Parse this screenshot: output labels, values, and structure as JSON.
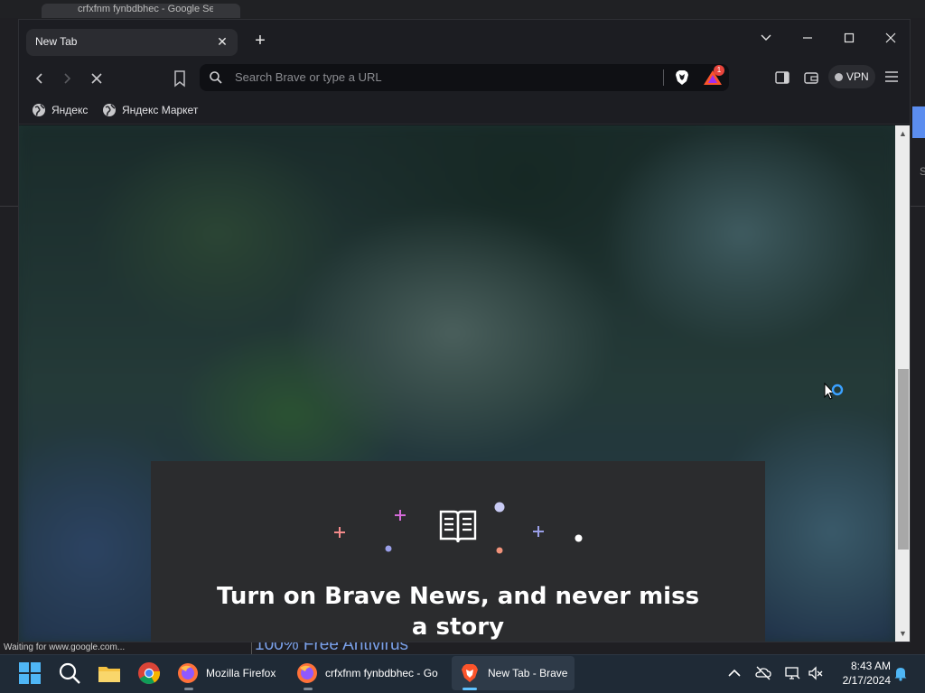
{
  "background_window": {
    "status_text": "Waiting for www.google.com...",
    "page_text": "100% Free Antivirus",
    "tab_title": "crfxfnm fynbdbhec - Google Se",
    "right_letter": "S"
  },
  "browser": {
    "tab": {
      "title": "New Tab",
      "close_glyph": "✕"
    },
    "new_tab_glyph": "+",
    "window_controls": {
      "dropdown": "⌵",
      "minimize": "—",
      "maximize": "☐",
      "close": "✕"
    },
    "nav": {
      "back": "‹",
      "forward": "›",
      "stop": "✕"
    },
    "address_bar": {
      "placeholder": "Search Brave or type a URL",
      "value": ""
    },
    "rewards_badge": "1",
    "vpn_label": "VPN",
    "bookmarks": [
      {
        "label": "Яндекс",
        "icon": "globe-icon"
      },
      {
        "label": "Яндекс Маркет",
        "icon": "globe-icon"
      }
    ],
    "news_card": {
      "heading": "Turn on Brave News, and never miss a story"
    }
  },
  "taskbar": {
    "apps": [
      {
        "label": "Mozilla Firefox",
        "icon": "firefox-icon"
      },
      {
        "label": "crfxfnm fynbdbhec - Go",
        "icon": "firefox-icon"
      },
      {
        "label": "New Tab - Brave",
        "icon": "brave-icon",
        "active": true
      }
    ],
    "clock": {
      "time": "8:43 AM",
      "date": "2/17/2024"
    }
  },
  "colors": {
    "accent": "#60c3ff",
    "card_bg": "#2b2c2e",
    "rewards_badge": "#e8453c",
    "brave_orange": "#fb542b"
  }
}
